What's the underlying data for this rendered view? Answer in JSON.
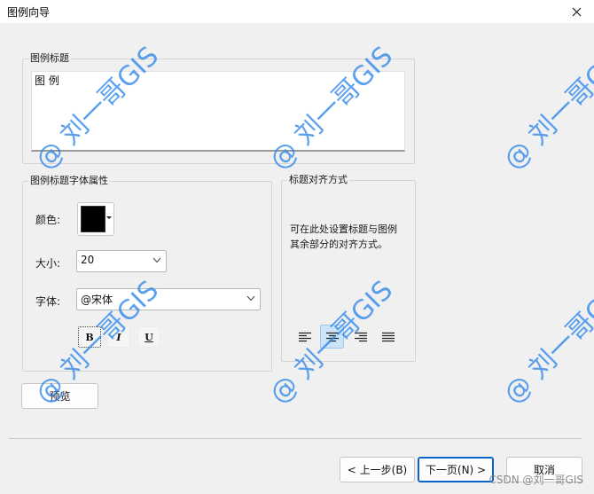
{
  "window": {
    "title": "图例向导"
  },
  "legend_title_group": {
    "label": "图例标题",
    "text": "图 例"
  },
  "font_group": {
    "label": "图例标题字体属性",
    "color_label": "颜色:",
    "color_value": "#000000",
    "size_label": "大小:",
    "size_value": "20",
    "font_label": "字体:",
    "font_value": "@宋体",
    "bold_label": "B",
    "italic_label": "I",
    "underline_label": "U"
  },
  "align_group": {
    "label": "标题对齐方式",
    "description": "可在此处设置标题与图例其余部分的对齐方式。",
    "selected": "center"
  },
  "buttons": {
    "preview": "预览",
    "back": "< 上一步(B)",
    "next": "下一页(N) >",
    "cancel": "取消"
  },
  "watermark": {
    "text": "@ 刘一哥GIS",
    "footer": "CSDN @刘一哥GIS"
  }
}
